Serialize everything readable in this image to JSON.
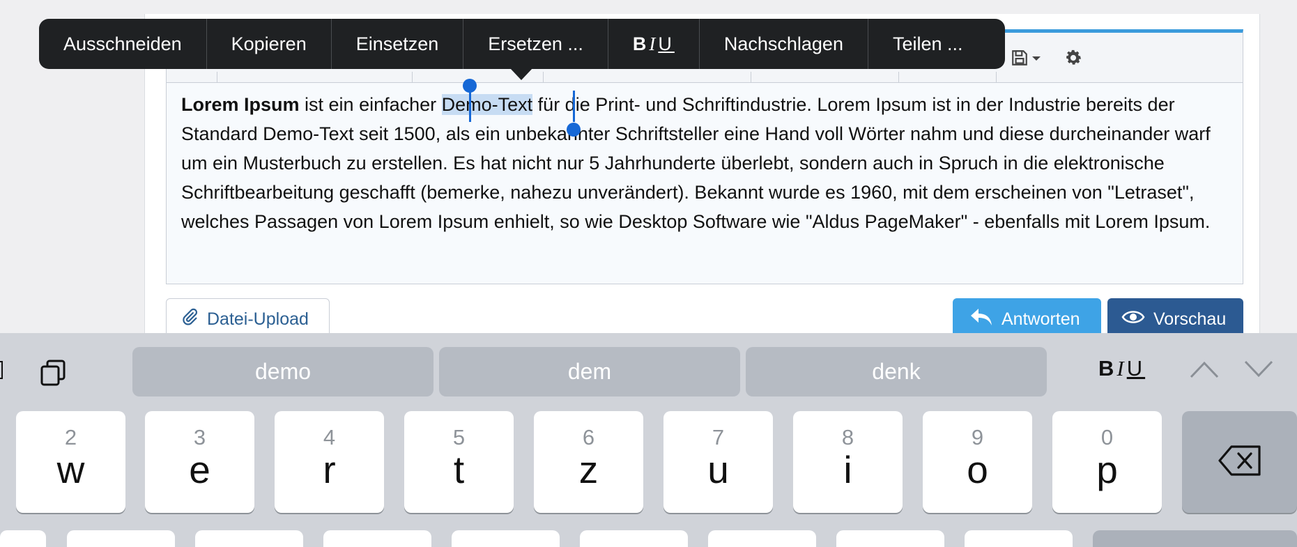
{
  "context_menu": {
    "items": [
      "Ausschneiden",
      "Kopieren",
      "Einsetzen",
      "Ersetzen ...",
      "Nachschlagen",
      "Teilen ..."
    ],
    "biu": {
      "b": "B",
      "i": "I",
      "u": "U"
    }
  },
  "editor": {
    "lead": "Lorem Ipsum",
    "before_selection": " ist ein einfacher ",
    "selection": "Demo-Text",
    "after_selection": " für die Print- und Schriftindustrie. Lorem Ipsum ist in der Industrie bereits der Standard Demo-Text seit 1500, als ein unbekannter Schriftsteller eine Hand voll Wörter nahm und diese durcheinander warf um ein Musterbuch zu erstellen. Es hat nicht nur 5 Jahrhunderte überlebt, sondern auch in Spruch in die elektronische Schriftbearbeitung geschafft (bemerke, nahezu unverändert). Bekannt wurde es 1960, mit dem erscheinen von \"Letraset\", welches Passagen von Lorem Ipsum enhielt, so wie Desktop Software wie \"Aldus PageMaker\" - ebenfalls mit Lorem Ipsum."
  },
  "buttons": {
    "upload": "Datei-Upload",
    "reply": "Antworten",
    "preview": "Vorschau"
  },
  "keyboard": {
    "suggestions": [
      "demo",
      "dem",
      "denk"
    ],
    "biu": {
      "b": "B",
      "i": "I",
      "u": "U"
    },
    "keys": [
      {
        "num": "2",
        "letter": "w"
      },
      {
        "num": "3",
        "letter": "e"
      },
      {
        "num": "4",
        "letter": "r"
      },
      {
        "num": "5",
        "letter": "t"
      },
      {
        "num": "6",
        "letter": "z"
      },
      {
        "num": "7",
        "letter": "u"
      },
      {
        "num": "8",
        "letter": "i"
      },
      {
        "num": "9",
        "letter": "o"
      },
      {
        "num": "0",
        "letter": "p"
      }
    ]
  },
  "colors": {
    "accent": "#3b9bdc",
    "selection": "#c7dcf3",
    "handle": "#1668d6",
    "reply_button": "#3ea3e6",
    "preview_button": "#2c5a92"
  },
  "icons": [
    "save-icon",
    "caret-down-icon",
    "gear-icon",
    "paperclip-icon",
    "reply-arrow-icon",
    "eye-icon",
    "clipboard-icon",
    "chevron-up-icon",
    "chevron-down-icon",
    "backspace-icon"
  ]
}
